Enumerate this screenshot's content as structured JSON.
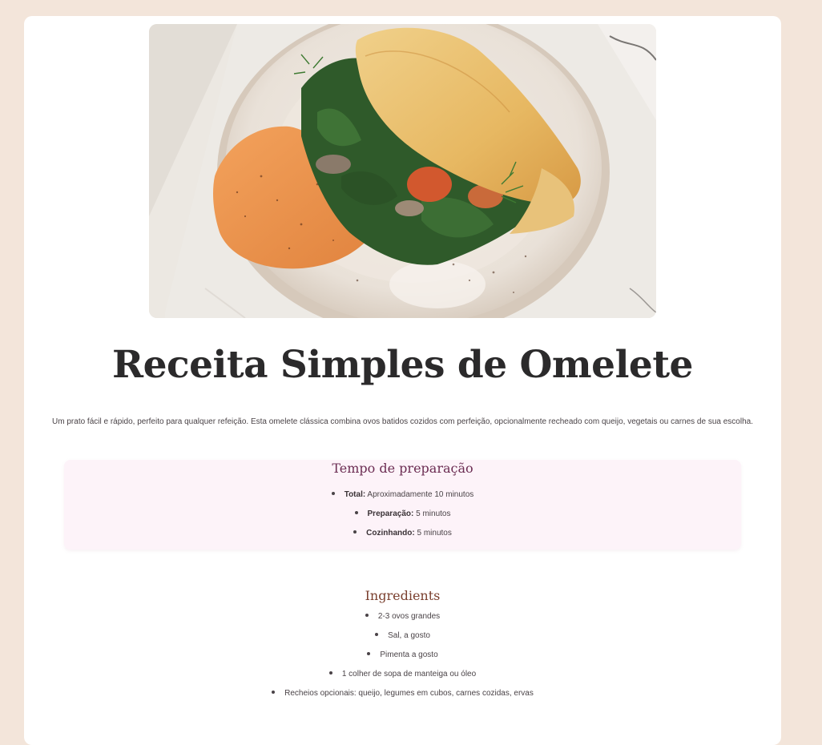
{
  "recipe": {
    "title": "Receita Simples de Omelete",
    "description": "Um prato fácil e rápido, perfeito para qualquer refeição. Esta omelete clássica combina ovos batidos cozidos com perfeição, opcionalmente recheado com queijo, vegetais ou carnes de sua escolha.",
    "hero_image": "omelette-with-spinach-and-hummus-photo"
  },
  "prep": {
    "title": "Tempo de preparação",
    "items": [
      {
        "label": "Total:",
        "value": "Aproximadamente 10 minutos"
      },
      {
        "label": "Preparação:",
        "value": "5 minutos"
      },
      {
        "label": "Cozinhando:",
        "value": "5 minutos"
      }
    ]
  },
  "ingredients": {
    "title": "Ingredients",
    "items": [
      "2-3 ovos grandes",
      "Sal, a gosto",
      "Pimenta a gosto",
      "1 colher de sopa de manteiga ou óleo",
      "Recheios opcionais: queijo, legumes em cubos, carnes cozidas, ervas"
    ]
  },
  "colors": {
    "page_background": "#f3e5da",
    "card_background": "#ffffff",
    "prep_box_background": "#fdf3f9",
    "prep_title_color": "#6b2c52",
    "ingredients_title_color": "#7a3f2e",
    "title_color": "#2b2a2b"
  }
}
